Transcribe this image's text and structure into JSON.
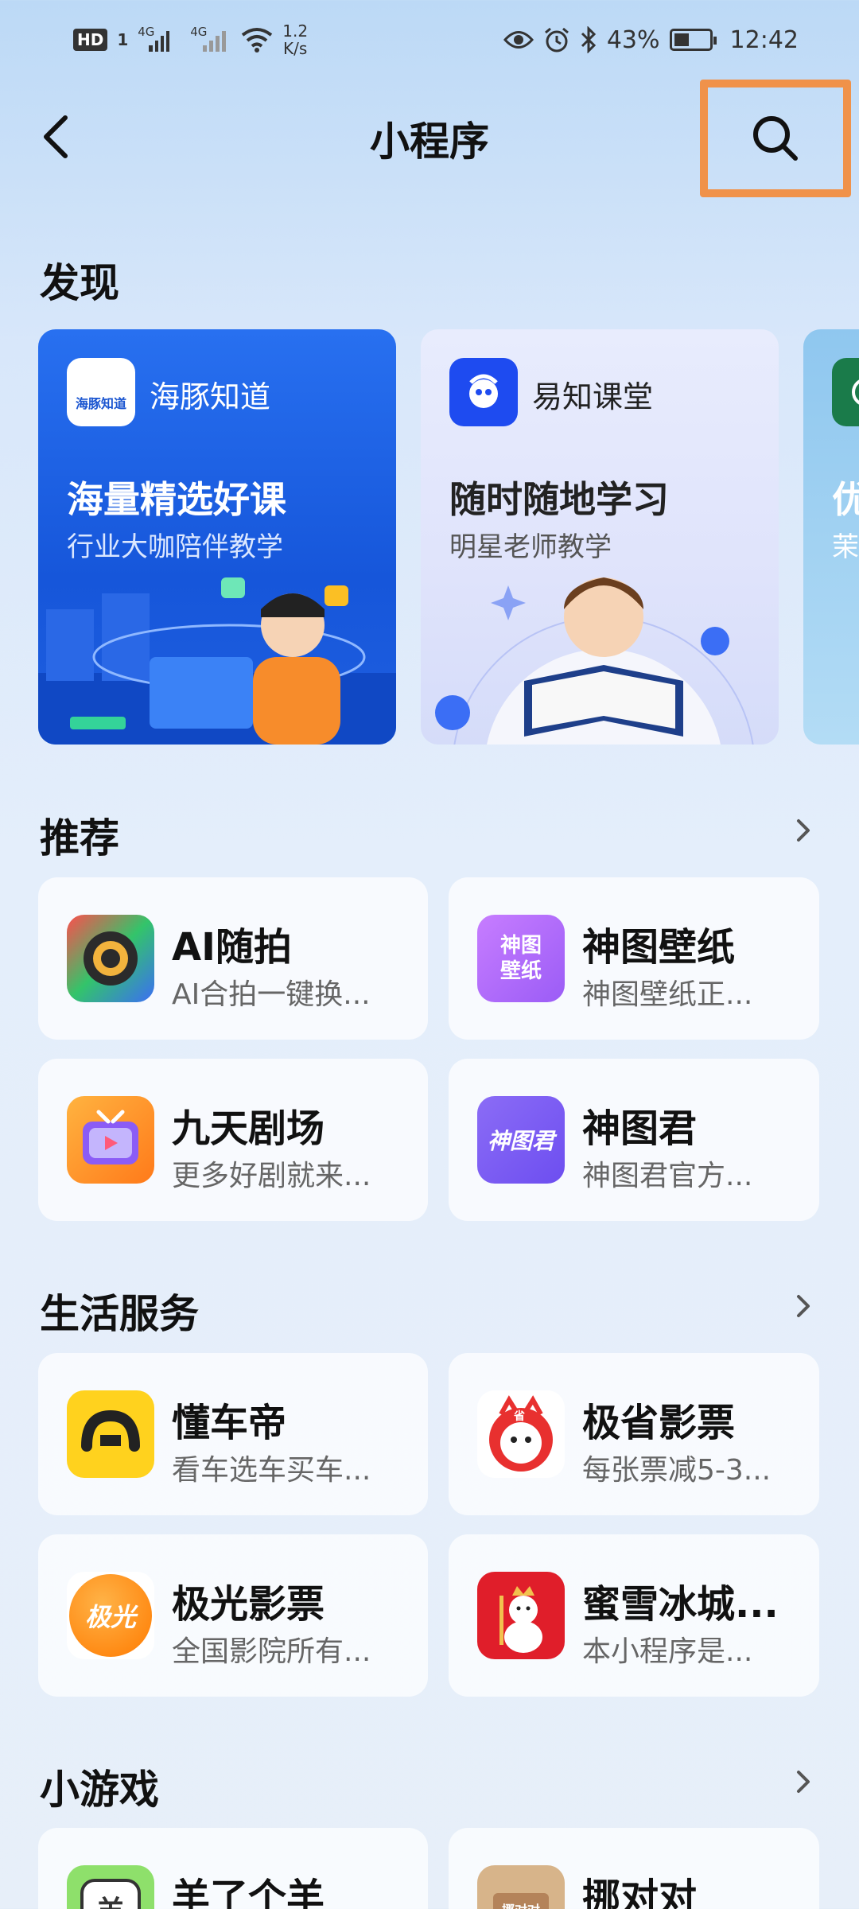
{
  "status_bar": {
    "hd": "HD",
    "sim": "1",
    "net1": "4G",
    "net2": "4G",
    "speed_value": "1.2",
    "speed_unit": "K/s",
    "battery": "43%",
    "time": "12:42"
  },
  "header": {
    "title": "小程序"
  },
  "sections": {
    "discover": "发现",
    "recommend": "推荐",
    "life": "生活服务",
    "games": "小游戏"
  },
  "discover_cards": [
    {
      "brand": "海豚知道",
      "logo_text": "海豚知道",
      "headline": "海量精选好课",
      "subline": "行业大咖陪伴教学"
    },
    {
      "brand": "易知课堂",
      "headline": "随时随地学习",
      "subline": "明星老师教学"
    },
    {
      "headline": "优",
      "subline": "茉"
    }
  ],
  "recommend": [
    {
      "name": "AI随拍",
      "desc": "AI合拍一键换..."
    },
    {
      "name": "神图壁纸",
      "desc": "神图壁纸正...",
      "icon_text": "神图壁纸"
    },
    {
      "name": "九天剧场",
      "desc": "更多好剧就来..."
    },
    {
      "name": "神图君",
      "desc": "神图君官方...",
      "icon_text": "神图君"
    }
  ],
  "life": [
    {
      "name": "懂车帝",
      "desc": "看车选车买车..."
    },
    {
      "name": "极省影票",
      "desc": "每张票减5-3...",
      "icon_text": "省"
    },
    {
      "name": "极光影票",
      "desc": "全国影院所有...",
      "icon_text": "极光"
    },
    {
      "name": "蜜雪冰城...",
      "desc": "本小程序是..."
    }
  ],
  "games": [
    {
      "name": "羊了个羊",
      "icon_text": "羊"
    },
    {
      "name": "挪对对",
      "icon_text": "挪对对"
    }
  ],
  "colors": {
    "accent_highlight": "#f0924a",
    "card1_bg": "#1a63e6",
    "card2_bg": "#dfe6fb"
  }
}
